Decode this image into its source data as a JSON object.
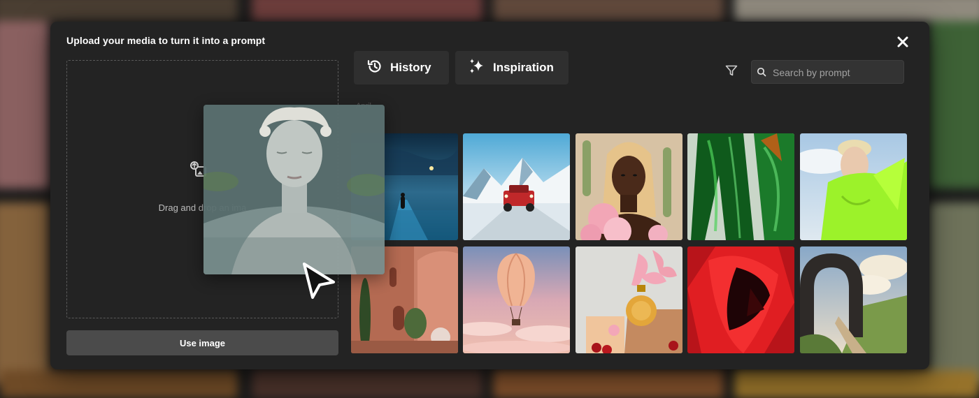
{
  "modal": {
    "title": "Upload your media to turn it into a prompt",
    "drop_text": "Drag and drop an ima",
    "use_image_label": "Use image"
  },
  "tabs": [
    {
      "label": "History",
      "icon": "history-icon"
    },
    {
      "label": "Inspiration",
      "icon": "sparkles-icon"
    }
  ],
  "search": {
    "placeholder": "Search by prompt",
    "value": ""
  },
  "gallery": {
    "section_label": "April",
    "images": [
      {
        "subject": "misty lake at night with lone figure"
      },
      {
        "subject": "red jeep driving on snowy mountain road"
      },
      {
        "subject": "woman with blonde hair and pink flowers"
      },
      {
        "subject": "green shiny leather outfit"
      },
      {
        "subject": "young man in neon green jacket"
      },
      {
        "subject": "terracotta building with cypress trees"
      },
      {
        "subject": "hot air balloon over pink clouds"
      },
      {
        "subject": "perfume bottle with orchids and cherries"
      },
      {
        "subject": "red veiled figure"
      },
      {
        "subject": "stone arch portal over green hill path"
      }
    ]
  },
  "drag_preview": {
    "subject": "pale young man floating in water with lily pads"
  },
  "icons": [
    "close-icon",
    "upload-image-icon",
    "filter-icon",
    "search-icon",
    "history-icon",
    "sparkles-icon",
    "cursor-icon"
  ],
  "colors": {
    "modal_bg": "#232323",
    "tab_bg": "#2f2f2f",
    "button_bg": "#4b4b4b",
    "text": "#ffffff"
  }
}
